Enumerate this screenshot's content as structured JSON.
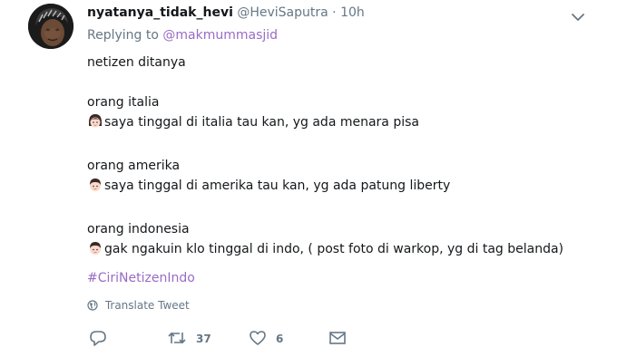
{
  "tweet": {
    "display_name": "nyatanya_tidak_hevi",
    "handle": "@HeviSaputra",
    "separator": "·",
    "time": "10h",
    "replying_to_prefix": "Replying to",
    "replying_to_handle": "@makmummasjid",
    "lines": {
      "l1": "netizen ditanya",
      "l2": "orang italia",
      "l3": "saya tinggal di italia tau kan, yg ada menara pisa",
      "l4": "orang amerika",
      "l5": "saya tinggal di amerika tau kan, yg ada patung liberty",
      "l6": "orang indonesia",
      "l7": "gak ngakuin klo tinggal di indo, ( post foto di warkop, yg di tag belanda)"
    },
    "emojis": {
      "girl": "girl-emoji",
      "boy": "boy-emoji",
      "boy2": "boy-emoji"
    },
    "hashtag": "#CiriNetizenIndo",
    "translate": "Translate Tweet",
    "actions": {
      "retweets": "37",
      "likes": "6"
    }
  },
  "colors": {
    "link": "#9a6bc6",
    "secondary_text": "#657786",
    "primary_text": "#14171a"
  }
}
